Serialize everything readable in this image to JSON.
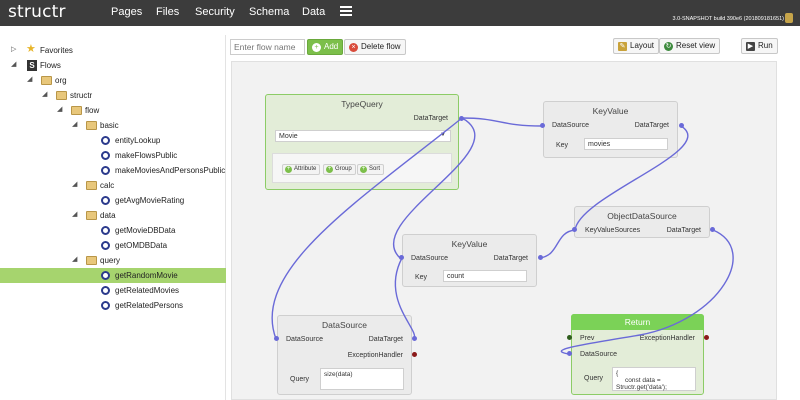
{
  "app": {
    "logo": "structr",
    "build": "3.0-SNAPSHOT build 390e6 (201809181651)"
  },
  "nav": [
    "Pages",
    "Files",
    "Security",
    "Schema",
    "Data"
  ],
  "tree": {
    "favorites": "Favorites",
    "flows": "Flows",
    "org": "org",
    "structr": "structr",
    "flow": "flow",
    "basic": "basic",
    "basic_items": [
      "entityLookup",
      "makeFlowsPublic",
      "makeMoviesAndPersonsPublic"
    ],
    "calc": "calc",
    "calc_items": [
      "getAvgMovieRating"
    ],
    "data": "data",
    "data_items": [
      "getMovieDBData",
      "getOMDBData"
    ],
    "query": "query",
    "query_items": [
      "getRandomMovie",
      "getRelatedMovies",
      "getRelatedPersons"
    ],
    "selected": "getRandomMovie"
  },
  "toolbar": {
    "flow_name_placeholder": "Enter flow name",
    "add": "Add",
    "delete_flow": "Delete flow",
    "layout": "Layout",
    "reset_view": "Reset view",
    "run": "Run"
  },
  "nodes": {
    "typequery": {
      "title": "TypeQuery",
      "out_port": "DataTarget",
      "select_value": "Movie",
      "buttons": [
        "Attribute",
        "Group",
        "Sort"
      ]
    },
    "keyvalue1": {
      "title": "KeyValue",
      "in_port": "DataSource",
      "out_port": "DataTarget",
      "key_label": "Key",
      "key_value": "movies"
    },
    "objectdatasource": {
      "title": "ObjectDataSource",
      "in_port": "KeyValueSources",
      "out_port": "DataTarget"
    },
    "keyvalue2": {
      "title": "KeyValue",
      "in_port": "DataSource",
      "out_port": "DataTarget",
      "key_label": "Key",
      "key_value": "count"
    },
    "datasource": {
      "title": "DataSource",
      "in_port": "DataSource",
      "out_port": "DataTarget",
      "exception_port": "ExceptionHandler",
      "query_label": "Query",
      "query_value": "size(data)"
    },
    "return": {
      "title": "Return",
      "prev_port": "Prev",
      "in_port": "DataSource",
      "exception_port": "ExceptionHandler",
      "query_label": "Query",
      "query_value": "{\n     const data =\nStructr.get('data');"
    }
  },
  "colors": {
    "topbar": "#3c3c3c",
    "accent_green": "#7bd257",
    "selected_row": "#a6d46e",
    "wire": "#6a6ad8"
  }
}
